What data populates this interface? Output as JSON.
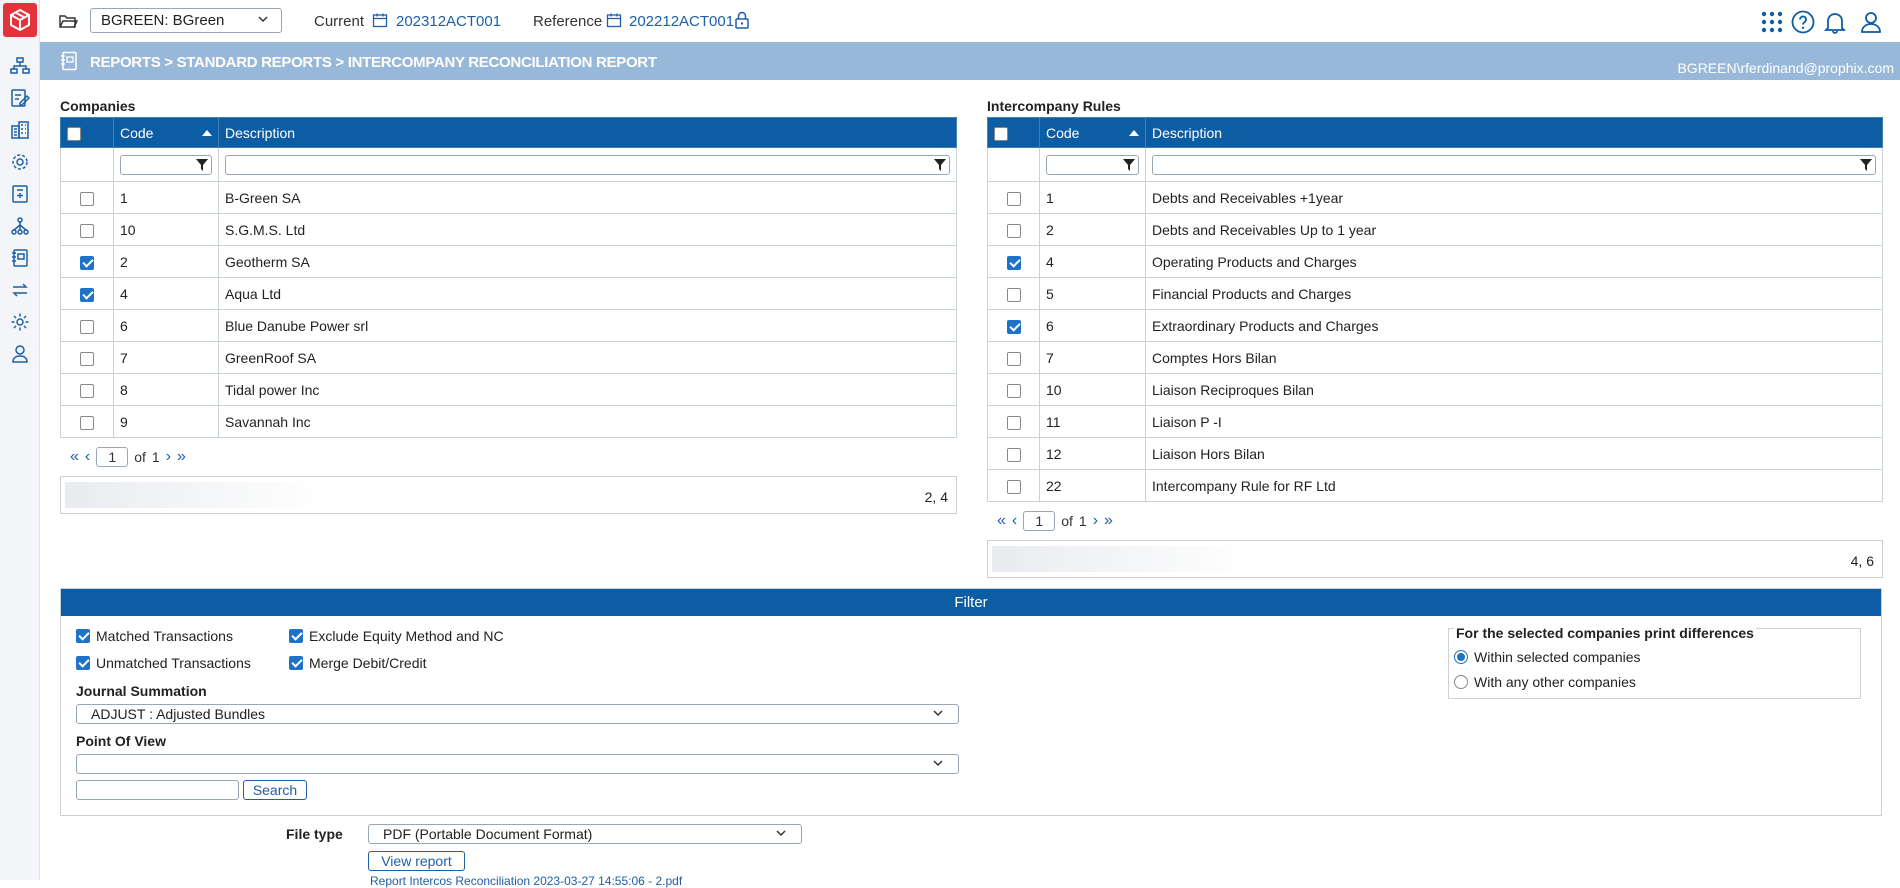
{
  "topbar": {
    "entity": "BGREEN: BGreen",
    "current_label": "Current",
    "current_value": "202312ACT001",
    "reference_label": "Reference",
    "reference_value": "202212ACT001"
  },
  "header": {
    "breadcrumb": "REPORTS > STANDARD REPORTS > INTERCOMPANY RECONCILIATION REPORT",
    "user": "BGREEN\\rferdinand@prophix.com"
  },
  "companies": {
    "title": "Companies",
    "col_code": "Code",
    "col_desc": "Description",
    "rows": [
      {
        "code": "1",
        "desc": "B-Green SA",
        "checked": false
      },
      {
        "code": "10",
        "desc": "S.G.M.S. Ltd",
        "checked": false
      },
      {
        "code": "2",
        "desc": "Geotherm SA",
        "checked": true
      },
      {
        "code": "4",
        "desc": "Aqua Ltd",
        "checked": true
      },
      {
        "code": "6",
        "desc": "Blue Danube Power srl",
        "checked": false
      },
      {
        "code": "7",
        "desc": "GreenRoof SA",
        "checked": false
      },
      {
        "code": "8",
        "desc": "Tidal power Inc",
        "checked": false
      },
      {
        "code": "9",
        "desc": "Savannah Inc",
        "checked": false
      }
    ],
    "page": "1",
    "of_label": "of",
    "total_pages": "1",
    "selection": "2, 4"
  },
  "rules": {
    "title": "Intercompany Rules",
    "col_code": "Code",
    "col_desc": "Description",
    "rows": [
      {
        "code": "1",
        "desc": "Debts and Receivables +1year",
        "checked": false
      },
      {
        "code": "2",
        "desc": "Debts and Receivables Up to 1 year",
        "checked": false
      },
      {
        "code": "4",
        "desc": "Operating Products and Charges",
        "checked": true
      },
      {
        "code": "5",
        "desc": "Financial Products and Charges",
        "checked": false
      },
      {
        "code": "6",
        "desc": "Extraordinary Products and Charges",
        "checked": true
      },
      {
        "code": "7",
        "desc": "Comptes Hors Bilan",
        "checked": false
      },
      {
        "code": "10",
        "desc": "Liaison Reciproques Bilan",
        "checked": false
      },
      {
        "code": "11",
        "desc": "Liaison P -I",
        "checked": false
      },
      {
        "code": "12",
        "desc": "Liaison Hors Bilan",
        "checked": false
      },
      {
        "code": "22",
        "desc": "Intercompany Rule for RF Ltd",
        "checked": false
      }
    ],
    "page": "1",
    "of_label": "of",
    "total_pages": "1",
    "selection": "4, 6"
  },
  "filter": {
    "title": "Filter",
    "matched": "Matched Transactions",
    "unmatched": "Unmatched Transactions",
    "exclude_equity": "Exclude Equity Method and NC",
    "merge_debit_credit": "Merge Debit/Credit",
    "journal_label": "Journal Summation",
    "journal_value": "ADJUST : Adjusted Bundles",
    "pov_label": "Point Of View",
    "pov_value": "",
    "search_button": "Search",
    "differences_title": "For the selected companies print differences",
    "option_within": "Within selected companies",
    "option_any": "With any other companies"
  },
  "output": {
    "filetype_label": "File type",
    "filetype_value": "PDF (Portable Document Format)",
    "view_button": "View report",
    "report_link": "Report Intercos Reconciliation 2023-03-27 14:55:06 - 2.pdf"
  }
}
